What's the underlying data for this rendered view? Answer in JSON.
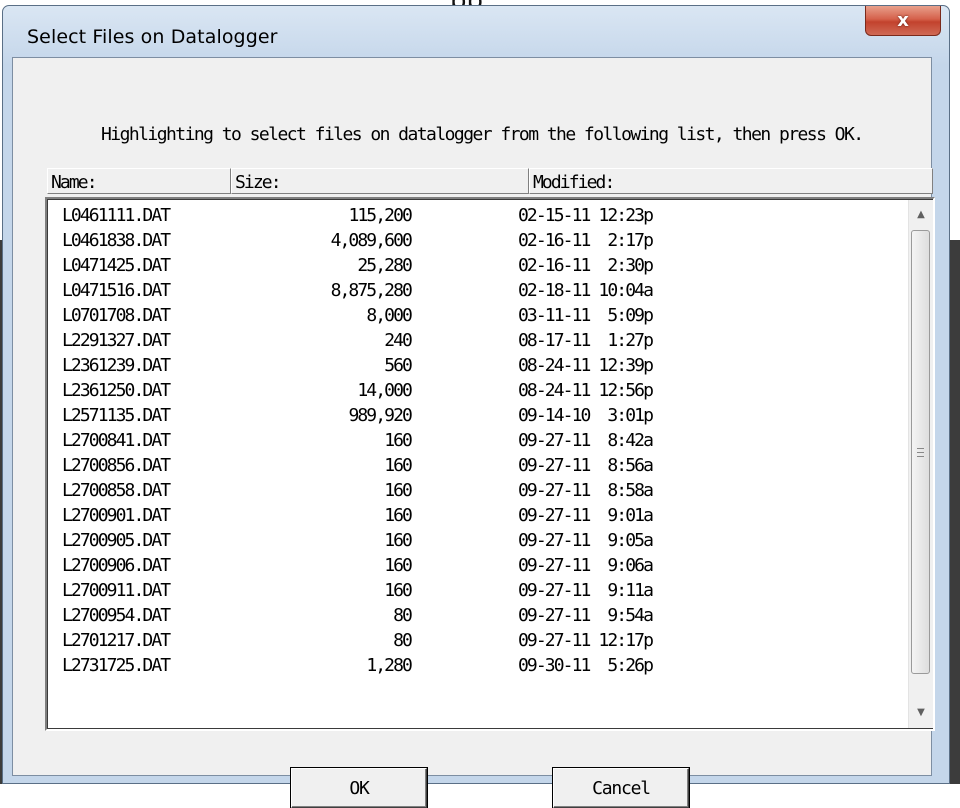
{
  "background": {
    "top_text": "pp",
    "colors": {
      "left_edge": "#3c3c3c"
    }
  },
  "window": {
    "title": "Select Files on Datalogger",
    "close_glyph": "x",
    "instruction": "Highlighting to select files on datalogger from the following list, then press OK."
  },
  "columns": {
    "name": "Name:",
    "size": "Size:",
    "modified": "Modified:"
  },
  "files": [
    {
      "name": "L0461111.DAT",
      "size": "115,200",
      "modified": "02-15-11 12:23p"
    },
    {
      "name": "L0461838.DAT",
      "size": "4,089,600",
      "modified": "02-16-11  2:17p"
    },
    {
      "name": "L0471425.DAT",
      "size": "25,280",
      "modified": "02-16-11  2:30p"
    },
    {
      "name": "L0471516.DAT",
      "size": "8,875,280",
      "modified": "02-18-11 10:04a"
    },
    {
      "name": "L0701708.DAT",
      "size": "8,000",
      "modified": "03-11-11  5:09p"
    },
    {
      "name": "L2291327.DAT",
      "size": "240",
      "modified": "08-17-11  1:27p"
    },
    {
      "name": "L2361239.DAT",
      "size": "560",
      "modified": "08-24-11 12:39p"
    },
    {
      "name": "L2361250.DAT",
      "size": "14,000",
      "modified": "08-24-11 12:56p"
    },
    {
      "name": "L2571135.DAT",
      "size": "989,920",
      "modified": "09-14-10  3:01p"
    },
    {
      "name": "L2700841.DAT",
      "size": "160",
      "modified": "09-27-11  8:42a"
    },
    {
      "name": "L2700856.DAT",
      "size": "160",
      "modified": "09-27-11  8:56a"
    },
    {
      "name": "L2700858.DAT",
      "size": "160",
      "modified": "09-27-11  8:58a"
    },
    {
      "name": "L2700901.DAT",
      "size": "160",
      "modified": "09-27-11  9:01a"
    },
    {
      "name": "L2700905.DAT",
      "size": "160",
      "modified": "09-27-11  9:05a"
    },
    {
      "name": "L2700906.DAT",
      "size": "160",
      "modified": "09-27-11  9:06a"
    },
    {
      "name": "L2700911.DAT",
      "size": "160",
      "modified": "09-27-11  9:11a"
    },
    {
      "name": "L2700954.DAT",
      "size": "80",
      "modified": "09-27-11  9:54a"
    },
    {
      "name": "L2701217.DAT",
      "size": "80",
      "modified": "09-27-11 12:17p"
    },
    {
      "name": "L2731725.DAT",
      "size": "1,280",
      "modified": "09-30-11  5:26p"
    }
  ],
  "scrollbar": {
    "up_icon": "▲",
    "down_icon": "▼",
    "icons": [
      "scroll-up-arrow-icon",
      "scroll-down-arrow-icon",
      "grip-icon"
    ]
  },
  "buttons": {
    "ok": "OK",
    "cancel": "Cancel"
  },
  "colors": {
    "close_button": "#c2422d",
    "client_bg": "#f0f0f0",
    "frame": "#c4d6ea"
  }
}
